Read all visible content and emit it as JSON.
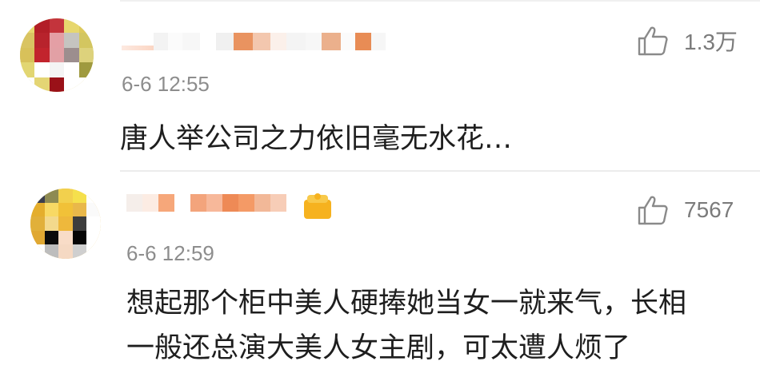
{
  "comments": [
    {
      "timestamp": "6-6 12:55",
      "text": "唐人举公司之力依旧毫无水花…",
      "like_count": "1.3万"
    },
    {
      "timestamp": "6-6 12:59",
      "text_line1": "想起那个柜中美人硬捧她当女一就来气，长相",
      "text_line2": "一般还总演大美人女主剧，可太遭人烦了",
      "like_count": "7567"
    }
  ],
  "icons": {
    "like": "thumbs-up-icon",
    "vip": "vip-badge-icon"
  },
  "colors": {
    "text": "#1e1e1e",
    "meta": "#8d8d8d",
    "like": "#7b7b7b"
  }
}
